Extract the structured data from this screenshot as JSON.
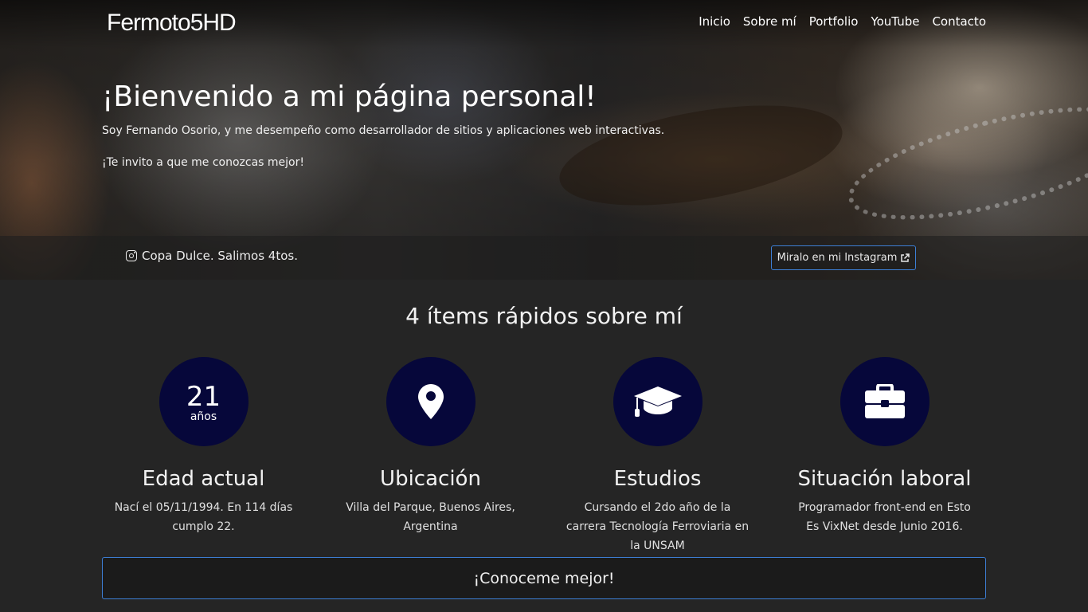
{
  "brand": "Fermoto5HD",
  "nav": {
    "items": [
      "Inicio",
      "Sobre mí",
      "Portfolio",
      "YouTube",
      "Contacto"
    ]
  },
  "hero": {
    "title": "¡Bienvenido a mi página personal!",
    "subtitle": "Soy Fernando Osorio, y me desempeño como desarrollador de sitios y aplicaciones web interactivas.",
    "invite": "¡Te invito a que me conozcas mejor!"
  },
  "instagram": {
    "icon": "instagram-icon",
    "caption": "Copa Dulce. Salimos 4tos.",
    "button_label": "Miralo en mi Instagram",
    "button_icon": "external-link-icon"
  },
  "section": {
    "title": "4 ítems rápidos sobre mí",
    "items": [
      {
        "icon": "age-counter",
        "age_number": "21",
        "age_unit": "años",
        "title": "Edad actual",
        "description": "Nací el 05/11/1994. En 114 días cumplo 22."
      },
      {
        "icon": "map-marker-icon",
        "title": "Ubicación",
        "description": "Villa del Parque, Buenos Aires, Argentina"
      },
      {
        "icon": "graduation-cap-icon",
        "title": "Estudios",
        "description": "Cursando el 2do año de la carrera Tecnología Ferroviaria en la UNSAM"
      },
      {
        "icon": "briefcase-icon",
        "title": "Situación laboral",
        "description": "Programador front-end en Esto Es VixNet desde Junio 2016."
      }
    ]
  },
  "cta": {
    "label": "¡Conoceme mejor!"
  },
  "colors": {
    "background": "#252525",
    "circle": "#06073a",
    "accent_border": "#3d7fd6"
  }
}
